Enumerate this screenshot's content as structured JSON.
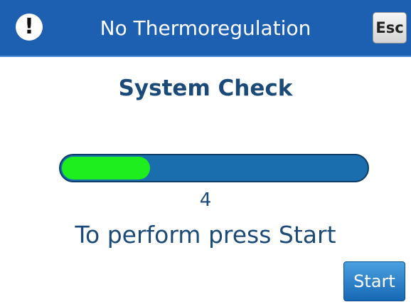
{
  "header": {
    "alert_icon": "exclamation-icon",
    "alert_glyph": "!",
    "title": "No Thermoregulation",
    "esc_label": "Esc",
    "background_color": "#1d5fb0"
  },
  "main": {
    "heading": "System Check",
    "progress": {
      "fraction": 0.29,
      "fill_color": "#1eee1e",
      "track_color": "#1a6ead"
    },
    "count": "4",
    "instruction": "To perform press Start",
    "start_label": "Start"
  },
  "colors": {
    "text": "#1b4a78",
    "button": "#1768b4"
  }
}
